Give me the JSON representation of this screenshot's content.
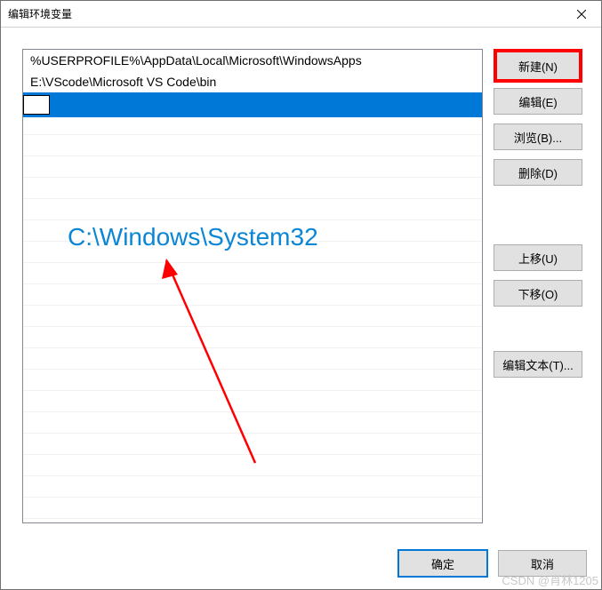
{
  "title": "编辑环境变量",
  "entries": [
    "%USERPROFILE%\\AppData\\Local\\Microsoft\\WindowsApps",
    "E:\\VScode\\Microsoft VS Code\\bin"
  ],
  "editing_value": "",
  "buttons": {
    "new": "新建(N)",
    "edit": "编辑(E)",
    "browse": "浏览(B)...",
    "delete": "删除(D)",
    "move_up": "上移(U)",
    "move_down": "下移(O)",
    "edit_text": "编辑文本(T)..."
  },
  "footer": {
    "ok": "确定",
    "cancel": "取消"
  },
  "annotation": "C:\\Windows\\System32",
  "watermark": "CSDN @肖林1205"
}
